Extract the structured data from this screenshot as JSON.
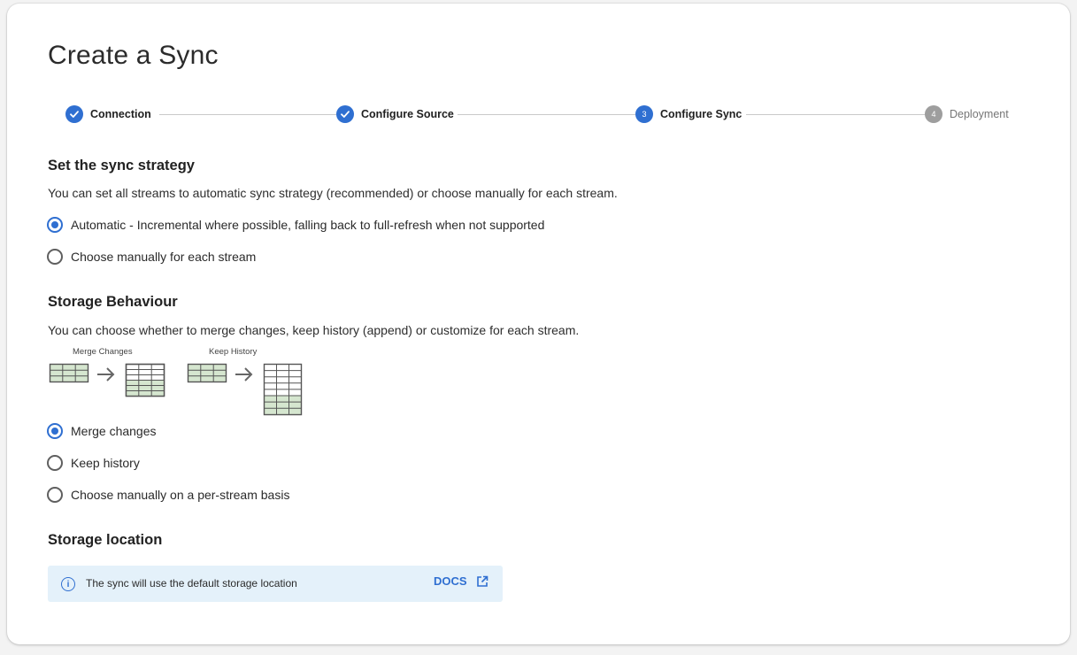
{
  "page": {
    "title": "Create a Sync"
  },
  "stepper": {
    "steps": [
      {
        "number": "1",
        "label": "Connection",
        "state": "done"
      },
      {
        "number": "2",
        "label": "Configure Source",
        "state": "done"
      },
      {
        "number": "3",
        "label": "Configure Sync",
        "state": "active"
      },
      {
        "number": "4",
        "label": "Deployment",
        "state": "pending"
      }
    ]
  },
  "sync_strategy": {
    "title": "Set the sync strategy",
    "description": "You can set all streams to automatic sync strategy (recommended) or choose manually for each stream.",
    "options": [
      {
        "label": "Automatic - Incremental where possible, falling back to full-refresh when not supported",
        "checked": true
      },
      {
        "label": "Choose manually for each stream",
        "checked": false
      }
    ]
  },
  "storage_behaviour": {
    "title": "Storage Behaviour",
    "description": "You can choose whether to merge changes, keep history (append) or customize for each stream.",
    "illustration": {
      "merge_caption": "Merge Changes",
      "history_caption": "Keep History"
    },
    "options": [
      {
        "label": "Merge changes",
        "checked": true
      },
      {
        "label": "Keep history",
        "checked": false
      },
      {
        "label": "Choose manually on a per-stream basis",
        "checked": false
      }
    ]
  },
  "storage_location": {
    "title": "Storage location",
    "info_text": "The sync will use the default storage location",
    "docs_label": "DOCS"
  },
  "colors": {
    "accent": "#2f6fd1",
    "info_bg": "#e4f1fa",
    "table_fill": "#d5e6cf"
  }
}
